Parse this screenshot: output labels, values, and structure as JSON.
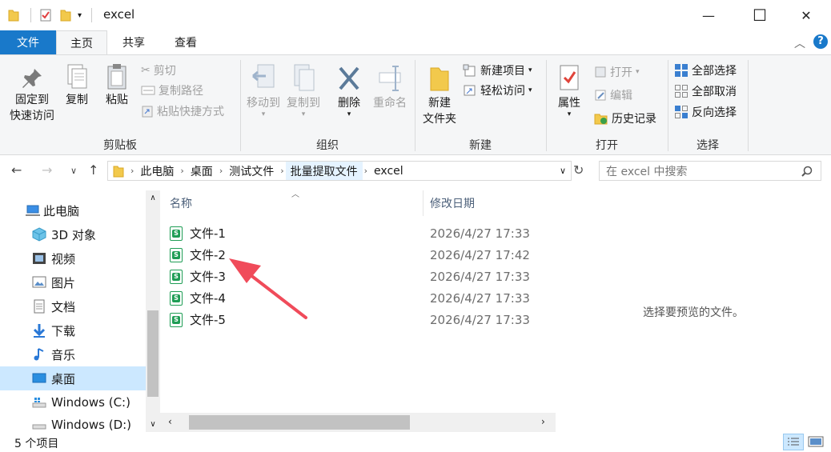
{
  "window": {
    "title": "excel",
    "minimize_glyph": "—",
    "maximize_glyph": "☐",
    "close_glyph": "✕"
  },
  "tabs": [
    {
      "label": "文件"
    },
    {
      "label": "主页"
    },
    {
      "label": "共享"
    },
    {
      "label": "查看"
    }
  ],
  "ribbon": {
    "clipboard": {
      "pin_label_1": "固定到",
      "pin_label_2": "快速访问",
      "copy": "复制",
      "paste": "粘贴",
      "cut": "剪切",
      "copy_path": "复制路径",
      "paste_shortcut": "粘贴快捷方式",
      "group": "剪贴板"
    },
    "organize": {
      "move_to": "移动到",
      "copy_to": "复制到",
      "delete": "删除",
      "rename": "重命名",
      "group": "组织"
    },
    "new": {
      "new_folder_1": "新建",
      "new_folder_2": "文件夹",
      "new_item": "新建项目",
      "easy_access": "轻松访问",
      "group": "新建"
    },
    "open": {
      "properties": "属性",
      "open": "打开",
      "edit": "编辑",
      "history": "历史记录",
      "group": "打开"
    },
    "select": {
      "select_all": "全部选择",
      "select_none": "全部取消",
      "invert": "反向选择",
      "group": "选择"
    }
  },
  "address": {
    "crumbs": [
      "此电脑",
      "桌面",
      "测试文件",
      "批量提取文件",
      "excel"
    ],
    "search_placeholder": "在 excel 中搜索"
  },
  "nav": {
    "items": [
      "此电脑",
      "3D 对象",
      "视频",
      "图片",
      "文档",
      "下载",
      "音乐",
      "桌面",
      "Windows (C:)",
      "Windows (D:)"
    ],
    "selected": "桌面"
  },
  "list": {
    "col_name": "名称",
    "col_date": "修改日期",
    "files": [
      {
        "name": "文件-1",
        "date": "2026/4/27 17:33"
      },
      {
        "name": "文件-2",
        "date": "2026/4/27 17:42"
      },
      {
        "name": "文件-3",
        "date": "2026/4/27 17:33"
      },
      {
        "name": "文件-4",
        "date": "2026/4/27 17:33"
      },
      {
        "name": "文件-5",
        "date": "2026/4/27 17:33"
      }
    ]
  },
  "preview": {
    "message": "选择要预览的文件。"
  },
  "status": {
    "count": "5 个项目"
  },
  "colors": {
    "accent": "#1979ca",
    "selection": "#cce8ff",
    "excel_green": "#1f9d55",
    "annotation_arrow": "#f04b5a"
  }
}
